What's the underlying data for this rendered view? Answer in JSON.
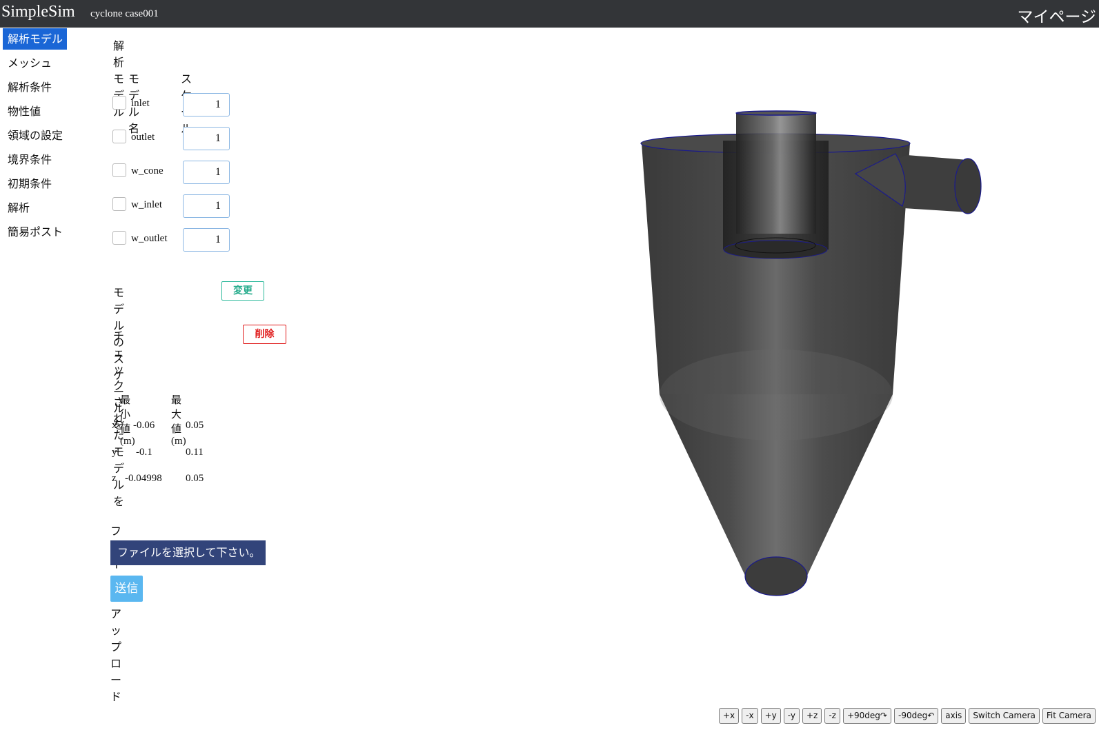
{
  "header": {
    "brand": "SimpleSim",
    "case_title": "cyclone case001",
    "mypage": "マイページ"
  },
  "sidebar": {
    "items": [
      {
        "label": "解析モデル",
        "active": true
      },
      {
        "label": "メッシュ"
      },
      {
        "label": "解析条件"
      },
      {
        "label": "物性値"
      },
      {
        "label": "領域の設定"
      },
      {
        "label": "境界条件"
      },
      {
        "label": "初期条件"
      },
      {
        "label": "解析"
      },
      {
        "label": "簡易ポスト"
      }
    ]
  },
  "main": {
    "title": "解析モデル",
    "col_model_name": "モデル名",
    "col_scale": "スケール",
    "models": [
      {
        "name": "inlet",
        "scale": "1",
        "checked": false
      },
      {
        "name": "outlet",
        "scale": "1",
        "checked": false
      },
      {
        "name": "w_cone",
        "scale": "1",
        "checked": false
      },
      {
        "name": "w_inlet",
        "scale": "1",
        "checked": false
      },
      {
        "name": "w_outlet",
        "scale": "1",
        "checked": false
      }
    ],
    "scale_change_text": "モデルのスケールを",
    "scale_change_button": "変更",
    "delete_text": "チェックされたモデルを",
    "delete_button": "削除",
    "bounds": {
      "col_min": "最小値(m)",
      "col_max": "最大値(m)",
      "rows": [
        {
          "axis": "x",
          "min": "-0.06",
          "max": "0.05"
        },
        {
          "axis": "y",
          "min": "-0.1",
          "max": "0.11"
        },
        {
          "axis": "z",
          "min": "-0.04998",
          "max": "0.05"
        }
      ]
    },
    "upload_title": "ファイルのアップロード",
    "file_select": "ファイルを選択して下さい。",
    "send_button": "送信"
  },
  "viewer": {
    "model_color": "#3b3b3b",
    "edge_color": "#1a1a8c",
    "camera_buttons": [
      "+x",
      "-x",
      "+y",
      "-y",
      "+z",
      "-z",
      "+90deg↷",
      "-90deg↶",
      "axis",
      "Switch Camera",
      "Fit Camera"
    ]
  }
}
